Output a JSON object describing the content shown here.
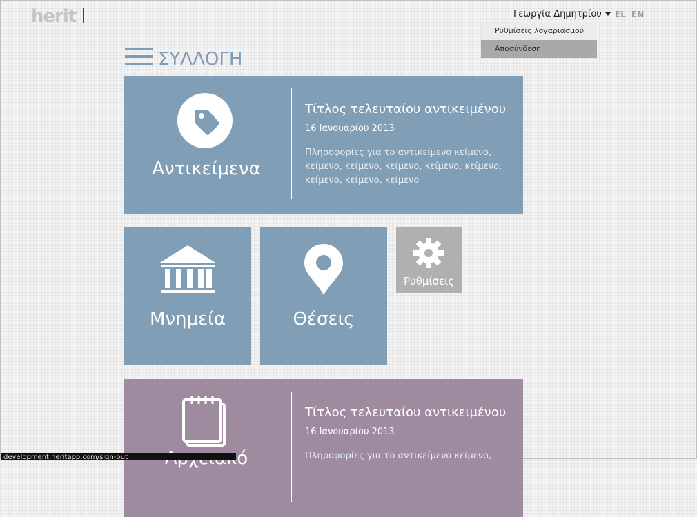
{
  "logo": {
    "text": "herit"
  },
  "user_menu": {
    "name": "Γεωργία Δημητρίου"
  },
  "languages": [
    "EL",
    "EN"
  ],
  "dropdown": {
    "items": [
      "Ρυθμίσεις λογαριασμού",
      "Αποσύνδεση"
    ]
  },
  "header": {
    "title": "ΣΥΛΛΟΓΗ"
  },
  "tiles": {
    "objects": {
      "label": "Αντικείμενα",
      "info_title": "Τίτλος τελευταίου αντικειμένου",
      "info_date": "16 Ιανουαρίου 2013",
      "info_body": "Πληροφορίες για το αντικείμενο κείμενο, κείμενο, κείμενο, κείμενο, κείμενο, κείμενο, κείμενο, κείμενο, κείμενο"
    },
    "monuments": {
      "label": "Μνημεία"
    },
    "places": {
      "label": "Θέσεις"
    },
    "settings": {
      "label": "Ρυθμίσεις"
    },
    "archive": {
      "label": "Αρχειακό",
      "info_title": "Τίτλος τελευταίου αντικειμένου",
      "info_date": "16 Ιανουαρίου 2013",
      "info_body": "Πληροφορίες για το αντικείμενο κείμενο,"
    }
  },
  "status_bar": {
    "url": "development.heritapp.com/sign-out"
  },
  "colors": {
    "accent": "#7f9cb6",
    "tile_blue": "#809eb5",
    "tile_purple": "#9e8b9f",
    "tile_grey": "#b0b0b0"
  },
  "icons": [
    "tag-icon",
    "museum-icon",
    "map-pin-icon",
    "gear-icon",
    "notepad-icon",
    "hamburger-menu-icon"
  ]
}
